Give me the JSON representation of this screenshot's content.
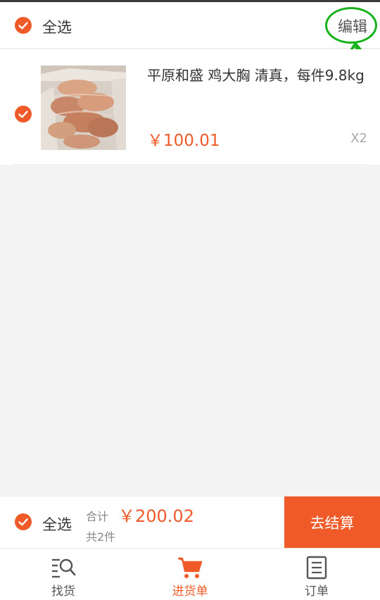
{
  "header": {
    "select_all_label": "全选",
    "edit_label": "编辑"
  },
  "cart": {
    "items": [
      {
        "title": "平原和盛 鸡大胸 清真，每件9.8kg",
        "price": "￥100.01",
        "quantity": "X2",
        "selected": true
      }
    ]
  },
  "checkout": {
    "select_all_label": "全选",
    "total_label": "合计",
    "total_price": "￥200.02",
    "count_label": "共2件",
    "button_label": "去结算"
  },
  "tabs": [
    {
      "label": "找货",
      "icon": "search-list-icon"
    },
    {
      "label": "进货单",
      "icon": "cart-icon",
      "active": true
    },
    {
      "label": "订单",
      "icon": "order-icon"
    }
  ],
  "colors": {
    "accent": "#f05a28",
    "annotation": "#18b31c"
  }
}
